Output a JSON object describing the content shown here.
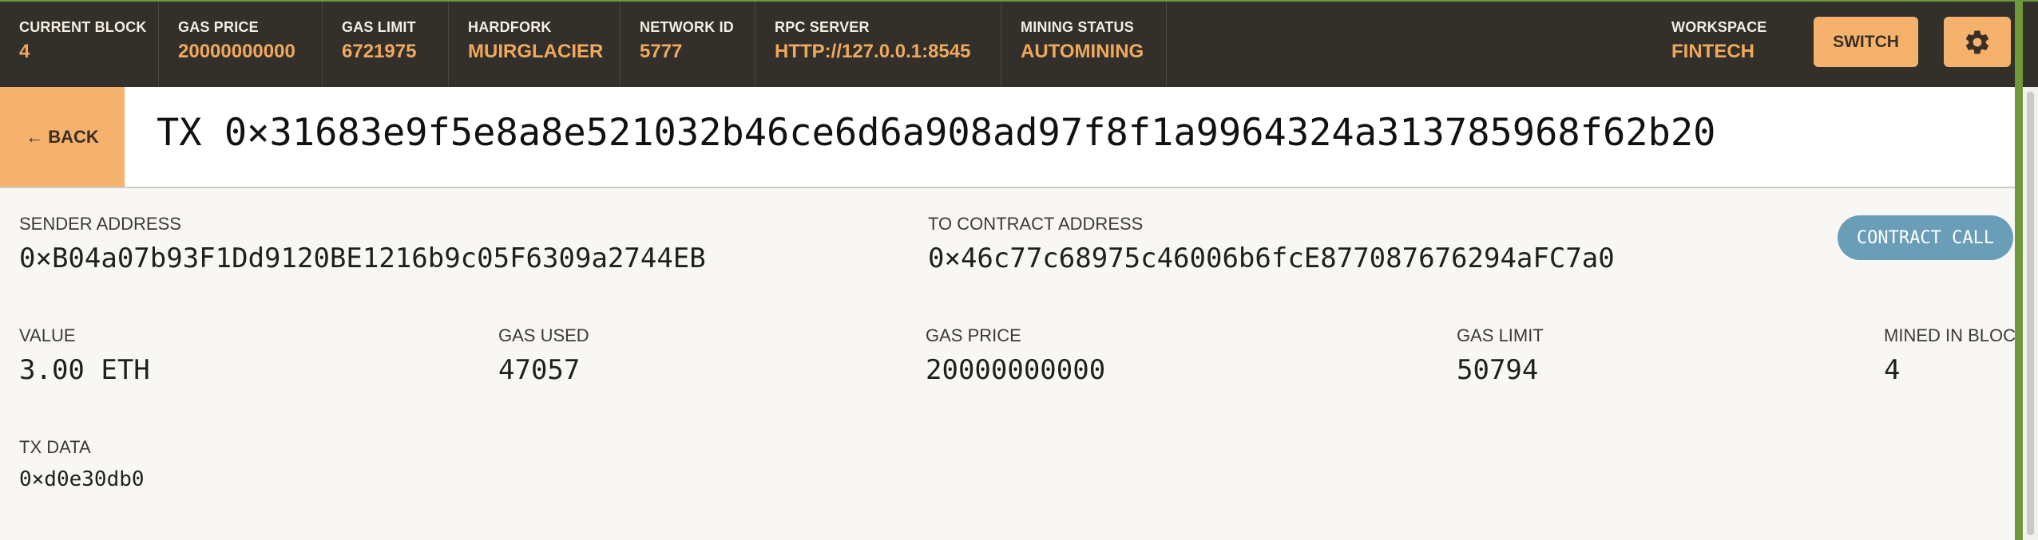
{
  "topbar": {
    "current_block": {
      "label": "CURRENT BLOCK",
      "value": "4"
    },
    "gas_price": {
      "label": "GAS PRICE",
      "value": "20000000000"
    },
    "gas_limit": {
      "label": "GAS LIMIT",
      "value": "6721975"
    },
    "hardfork": {
      "label": "HARDFORK",
      "value": "MUIRGLACIER"
    },
    "network_id": {
      "label": "NETWORK ID",
      "value": "5777"
    },
    "rpc_server": {
      "label": "RPC SERVER",
      "value": "HTTP://127.0.0.1:8545"
    },
    "mining_status": {
      "label": "MINING STATUS",
      "value": "AUTOMINING"
    },
    "workspace": {
      "label": "WORKSPACE",
      "value": "FINTECH"
    },
    "switch_label": "SWITCH",
    "settings_icon": "gear-icon"
  },
  "header": {
    "back_label": "← BACK",
    "title": "TX 0×31683e9f5e8a8e521032b46ce6d6a908ad97f8f1a9964324a313785968f62b20"
  },
  "details": {
    "sender": {
      "label": "SENDER ADDRESS",
      "value": "0×B04a07b93F1Dd9120BE1216b9c05F6309a2744EB"
    },
    "to_contract": {
      "label": "TO CONTRACT ADDRESS",
      "value": "0×46c77c68975c46006b6fcE877087676294aFC7a0"
    },
    "badge": "CONTRACT CALL",
    "value": {
      "label": "VALUE",
      "value": "3.00 ETH"
    },
    "gas_used": {
      "label": "GAS USED",
      "value": "47057"
    },
    "gas_price": {
      "label": "GAS PRICE",
      "value": "20000000000"
    },
    "gas_limit": {
      "label": "GAS LIMIT",
      "value": "50794"
    },
    "mined_in_block": {
      "label": "MINED IN BLOCK",
      "value": "4"
    },
    "tx_data": {
      "label": "TX DATA",
      "value": "0×d0e30db0"
    }
  },
  "colors": {
    "topbar_bg": "#33302b",
    "accent_orange": "#f0a95c",
    "button_orange": "#f4b26c",
    "badge_blue": "#6a9eb8",
    "scroll_green": "#6f9a3c"
  }
}
